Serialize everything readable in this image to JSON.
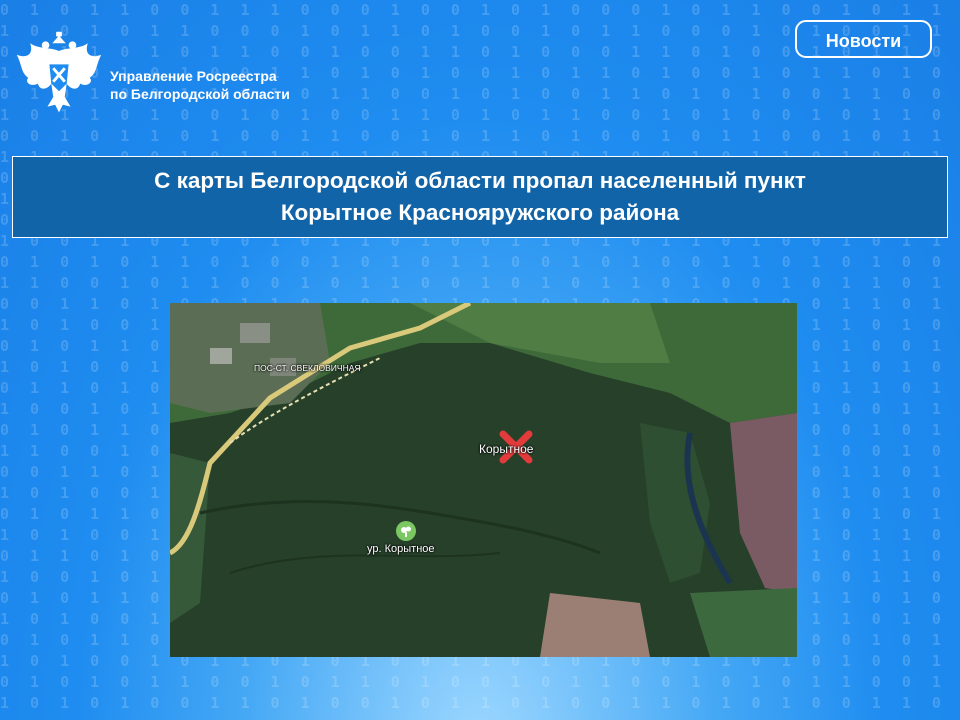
{
  "header": {
    "org_line1": "Управление Росреестра",
    "org_line2": "по Белгородской области",
    "news_button": "Новости"
  },
  "title": {
    "line1": "С карты Белгородской области пропал населенный пункт",
    "line2": "Корытное Краснояружского района"
  },
  "map": {
    "settlement_label": "пос-ст. свекловичная",
    "village_label": "Корытное",
    "tract_label": "ур. Корытное"
  },
  "icons": {
    "logo": "double-headed-eagle-icon",
    "removed_marker": "red-cross-icon",
    "tract_marker": "tree-icon"
  },
  "colors": {
    "background": "#1e8cf0",
    "title_box": "#1264a8",
    "removed_marker": "#e23b3b"
  }
}
